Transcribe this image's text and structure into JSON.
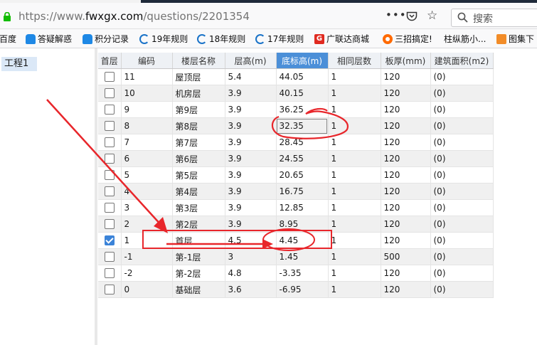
{
  "browser": {
    "url_prefix": "https://www.",
    "url_domain": "fwxgx.com",
    "url_path": "/questions/2201354",
    "more_glyph": "•••",
    "search_placeholder": "搜索"
  },
  "bookmarks": [
    {
      "label": "百度",
      "icon": "none"
    },
    {
      "label": "答疑解惑",
      "icon": "database-icon"
    },
    {
      "label": "积分记录",
      "icon": "database-icon"
    },
    {
      "label": "19年规则",
      "icon": "e-icon"
    },
    {
      "label": "18年规则",
      "icon": "e-icon"
    },
    {
      "label": "17年规则",
      "icon": "e-icon"
    },
    {
      "label": "广联达商城",
      "icon": "g-icon"
    },
    {
      "label": "三招搞定!",
      "icon": "q-icon"
    },
    {
      "label": "柱纵筋小...",
      "icon": "none"
    },
    {
      "label": "图集下",
      "icon": "image-icon"
    }
  ],
  "left_panel": {
    "project_label": "工程1"
  },
  "table": {
    "columns": [
      "首层",
      "编码",
      "楼层名称",
      "层高(m)",
      "底标高(m)",
      "相同层数",
      "板厚(mm)",
      "建筑面积(m2)"
    ],
    "highlighted_column": "底标高(m)",
    "rows": [
      {
        "first": false,
        "code": "11",
        "name": "屋顶层",
        "height": "5.4",
        "bottom": "44.05",
        "same": "1",
        "thick": "120",
        "area": "(0)"
      },
      {
        "first": false,
        "code": "10",
        "name": "机房层",
        "height": "3.9",
        "bottom": "40.15",
        "same": "1",
        "thick": "120",
        "area": "(0)"
      },
      {
        "first": false,
        "code": "9",
        "name": "第9层",
        "height": "3.9",
        "bottom": "36.25",
        "same": "1",
        "thick": "120",
        "area": "(0)"
      },
      {
        "first": false,
        "code": "8",
        "name": "第8层",
        "height": "3.9",
        "bottom": "32.35",
        "same": "1",
        "thick": "120",
        "area": "(0)"
      },
      {
        "first": false,
        "code": "7",
        "name": "第7层",
        "height": "3.9",
        "bottom": "28.45",
        "same": "1",
        "thick": "120",
        "area": "(0)"
      },
      {
        "first": false,
        "code": "6",
        "name": "第6层",
        "height": "3.9",
        "bottom": "24.55",
        "same": "1",
        "thick": "120",
        "area": "(0)"
      },
      {
        "first": false,
        "code": "5",
        "name": "第5层",
        "height": "3.9",
        "bottom": "20.65",
        "same": "1",
        "thick": "120",
        "area": "(0)"
      },
      {
        "first": false,
        "code": "4",
        "name": "第4层",
        "height": "3.9",
        "bottom": "16.75",
        "same": "1",
        "thick": "120",
        "area": "(0)"
      },
      {
        "first": false,
        "code": "3",
        "name": "第3层",
        "height": "3.9",
        "bottom": "12.85",
        "same": "1",
        "thick": "120",
        "area": "(0)"
      },
      {
        "first": false,
        "code": "2",
        "name": "第2层",
        "height": "3.9",
        "bottom": "8.95",
        "same": "1",
        "thick": "120",
        "area": "(0)"
      },
      {
        "first": true,
        "code": "1",
        "name": "首层",
        "height": "4.5",
        "bottom": "4.45",
        "same": "1",
        "thick": "120",
        "area": "(0)"
      },
      {
        "first": false,
        "code": "-1",
        "name": "第-1层",
        "height": "3",
        "bottom": "1.45",
        "same": "1",
        "thick": "500",
        "area": "(0)"
      },
      {
        "first": false,
        "code": "-2",
        "name": "第-2层",
        "height": "4.8",
        "bottom": "-3.35",
        "same": "1",
        "thick": "120",
        "area": "(0)"
      },
      {
        "first": false,
        "code": "0",
        "name": "基础层",
        "height": "3.6",
        "bottom": "-6.95",
        "same": "1",
        "thick": "120",
        "area": "(0)"
      }
    ]
  },
  "annotation": {
    "color": "#e8262b"
  }
}
